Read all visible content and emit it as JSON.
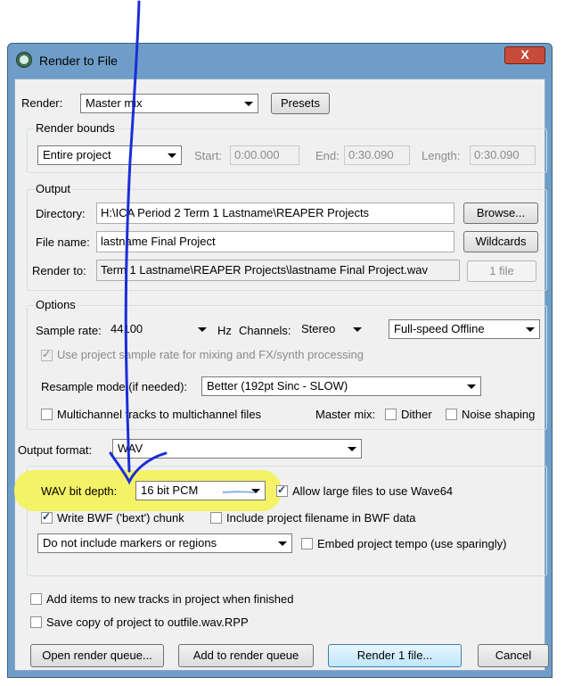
{
  "window": {
    "title": "Render to File",
    "close_label": "X"
  },
  "render": {
    "label": "Render:",
    "value": "Master mix",
    "presets_label": "Presets"
  },
  "bounds": {
    "group_title": "Render bounds",
    "value": "Entire project",
    "start_label": "Start:",
    "start_value": "0:00.000",
    "end_label": "End:",
    "end_value": "0:30.090",
    "length_label": "Length:",
    "length_value": "0:30.090"
  },
  "output": {
    "group_title": "Output",
    "directory_label": "Directory:",
    "directory_value": "H:\\ICA Period 2 Term 1 Lastname\\REAPER Projects",
    "browse_label": "Browse...",
    "filename_label": "File name:",
    "filename_value": "lastname Final Project",
    "wildcards_label": "Wildcards",
    "renderto_label": "Render to:",
    "renderto_value": "Term 1 Lastname\\REAPER Projects\\lastname Final Project.wav",
    "files_label": "1 file"
  },
  "options": {
    "group_title": "Options",
    "samplerate_label": "Sample rate:",
    "samplerate_value": "44100",
    "hz_label": "Hz",
    "channels_label": "Channels:",
    "channels_value": "Stereo",
    "speed_value": "Full-speed Offline",
    "use_project_rate_label": "Use project sample rate for mixing and FX/synth processing",
    "resample_label": "Resample mode (if needed):",
    "resample_value": "Better (192pt Sinc - SLOW)",
    "multichannel_label": "Multichannel tracks to multichannel files",
    "mastermix_label": "Master mix:",
    "dither_label": "Dither",
    "noiseshaping_label": "Noise shaping"
  },
  "format": {
    "label": "Output format:",
    "value": "WAV",
    "bitdepth_label": "WAV bit depth:",
    "bitdepth_value": "16 bit PCM",
    "wave64_label": "Allow large files to use Wave64",
    "bwf_label": "Write BWF ('bext') chunk",
    "include_filename_label": "Include project filename in BWF data",
    "markers_value": "Do not include markers or regions",
    "embed_tempo_label": "Embed project tempo (use sparingly)"
  },
  "footer": {
    "add_items_label": "Add items to new tracks in project when finished",
    "save_copy_label": "Save copy of project to outfile.wav.RPP",
    "open_queue_label": "Open render queue...",
    "add_queue_label": "Add to render queue",
    "render_label": "Render 1 file...",
    "cancel_label": "Cancel"
  },
  "colors": {
    "titlebar": "#6e9ec7",
    "highlight": "#f4f25a",
    "annotation_pen": "#1a2ed8",
    "close_button": "#c74b3b"
  }
}
